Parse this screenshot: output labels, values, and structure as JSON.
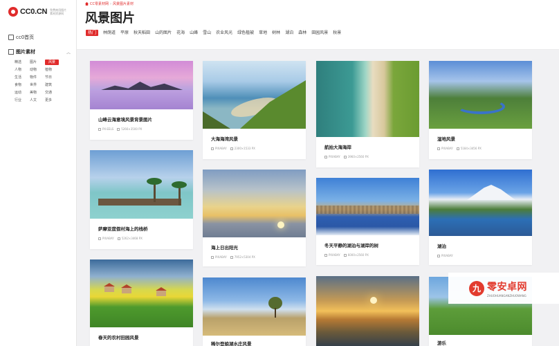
{
  "sidebar": {
    "logo_text": "CC0.CN",
    "logo_sub": "免费商用图片素材资源网",
    "home_label": "cc0首页",
    "section_label": "图片素材",
    "categories": [
      "精选",
      "图片",
      "风景",
      "人物",
      "动物",
      "植物",
      "生活",
      "物件",
      "节日",
      "食物",
      "世界",
      "建筑",
      "运动",
      "美物",
      "交通",
      "行业",
      "人文",
      "更多"
    ],
    "active_category": "风景"
  },
  "header": {
    "breadcrumb_home": "CC零素材网",
    "breadcrumb_current": "风景图片素材",
    "title": "风景图片",
    "tags": [
      "热门",
      "林荫道",
      "平原",
      "秋天稻田",
      "山的图片",
      "花海",
      "山峰",
      "雪山",
      "农业风光",
      "绿色植被",
      "草地",
      "树林",
      "湖泊",
      "森林",
      "田园风景",
      "秋景"
    ]
  },
  "cards": [
    {
      "title": "山峰云海意境风景背景图片",
      "source": "PX-EELS",
      "size": "5266×3500 PX"
    },
    {
      "title": "萨摩亚度假村海上的栈桥",
      "source": "PIXABAY",
      "size": "5262×3468 PX"
    },
    {
      "title": "春天的农村田园风景",
      "source": "",
      "size": ""
    },
    {
      "title": "大海海湾风景",
      "source": "PIXABAY",
      "size": "2300×1533 PX"
    },
    {
      "title": "海上日出阳光",
      "source": "PIXABAY",
      "size": "7952×5304 PX"
    },
    {
      "title": "稀尔登娘湖水庄风景",
      "source": "",
      "size": ""
    },
    {
      "title": "航拍大海海岸",
      "source": "PIXABAY",
      "size": "3960×2560 PX"
    },
    {
      "title": "冬天平静的湖泊与湖岸的树",
      "source": "PIXABAY",
      "size": "6000×2560 PX"
    },
    {
      "title": "",
      "source": "",
      "size": ""
    },
    {
      "title": "湿地风景",
      "source": "PIXABAY",
      "size": "5184×3456 PX"
    },
    {
      "title": "湖泊",
      "source": "PIXABAY",
      "size": ""
    },
    {
      "title": "游乐",
      "source": "",
      "size": ""
    }
  ],
  "watermark": {
    "glyph": "九",
    "title": "零安卓网",
    "sub": "ZHUOHUANGANZHUOWANG"
  }
}
